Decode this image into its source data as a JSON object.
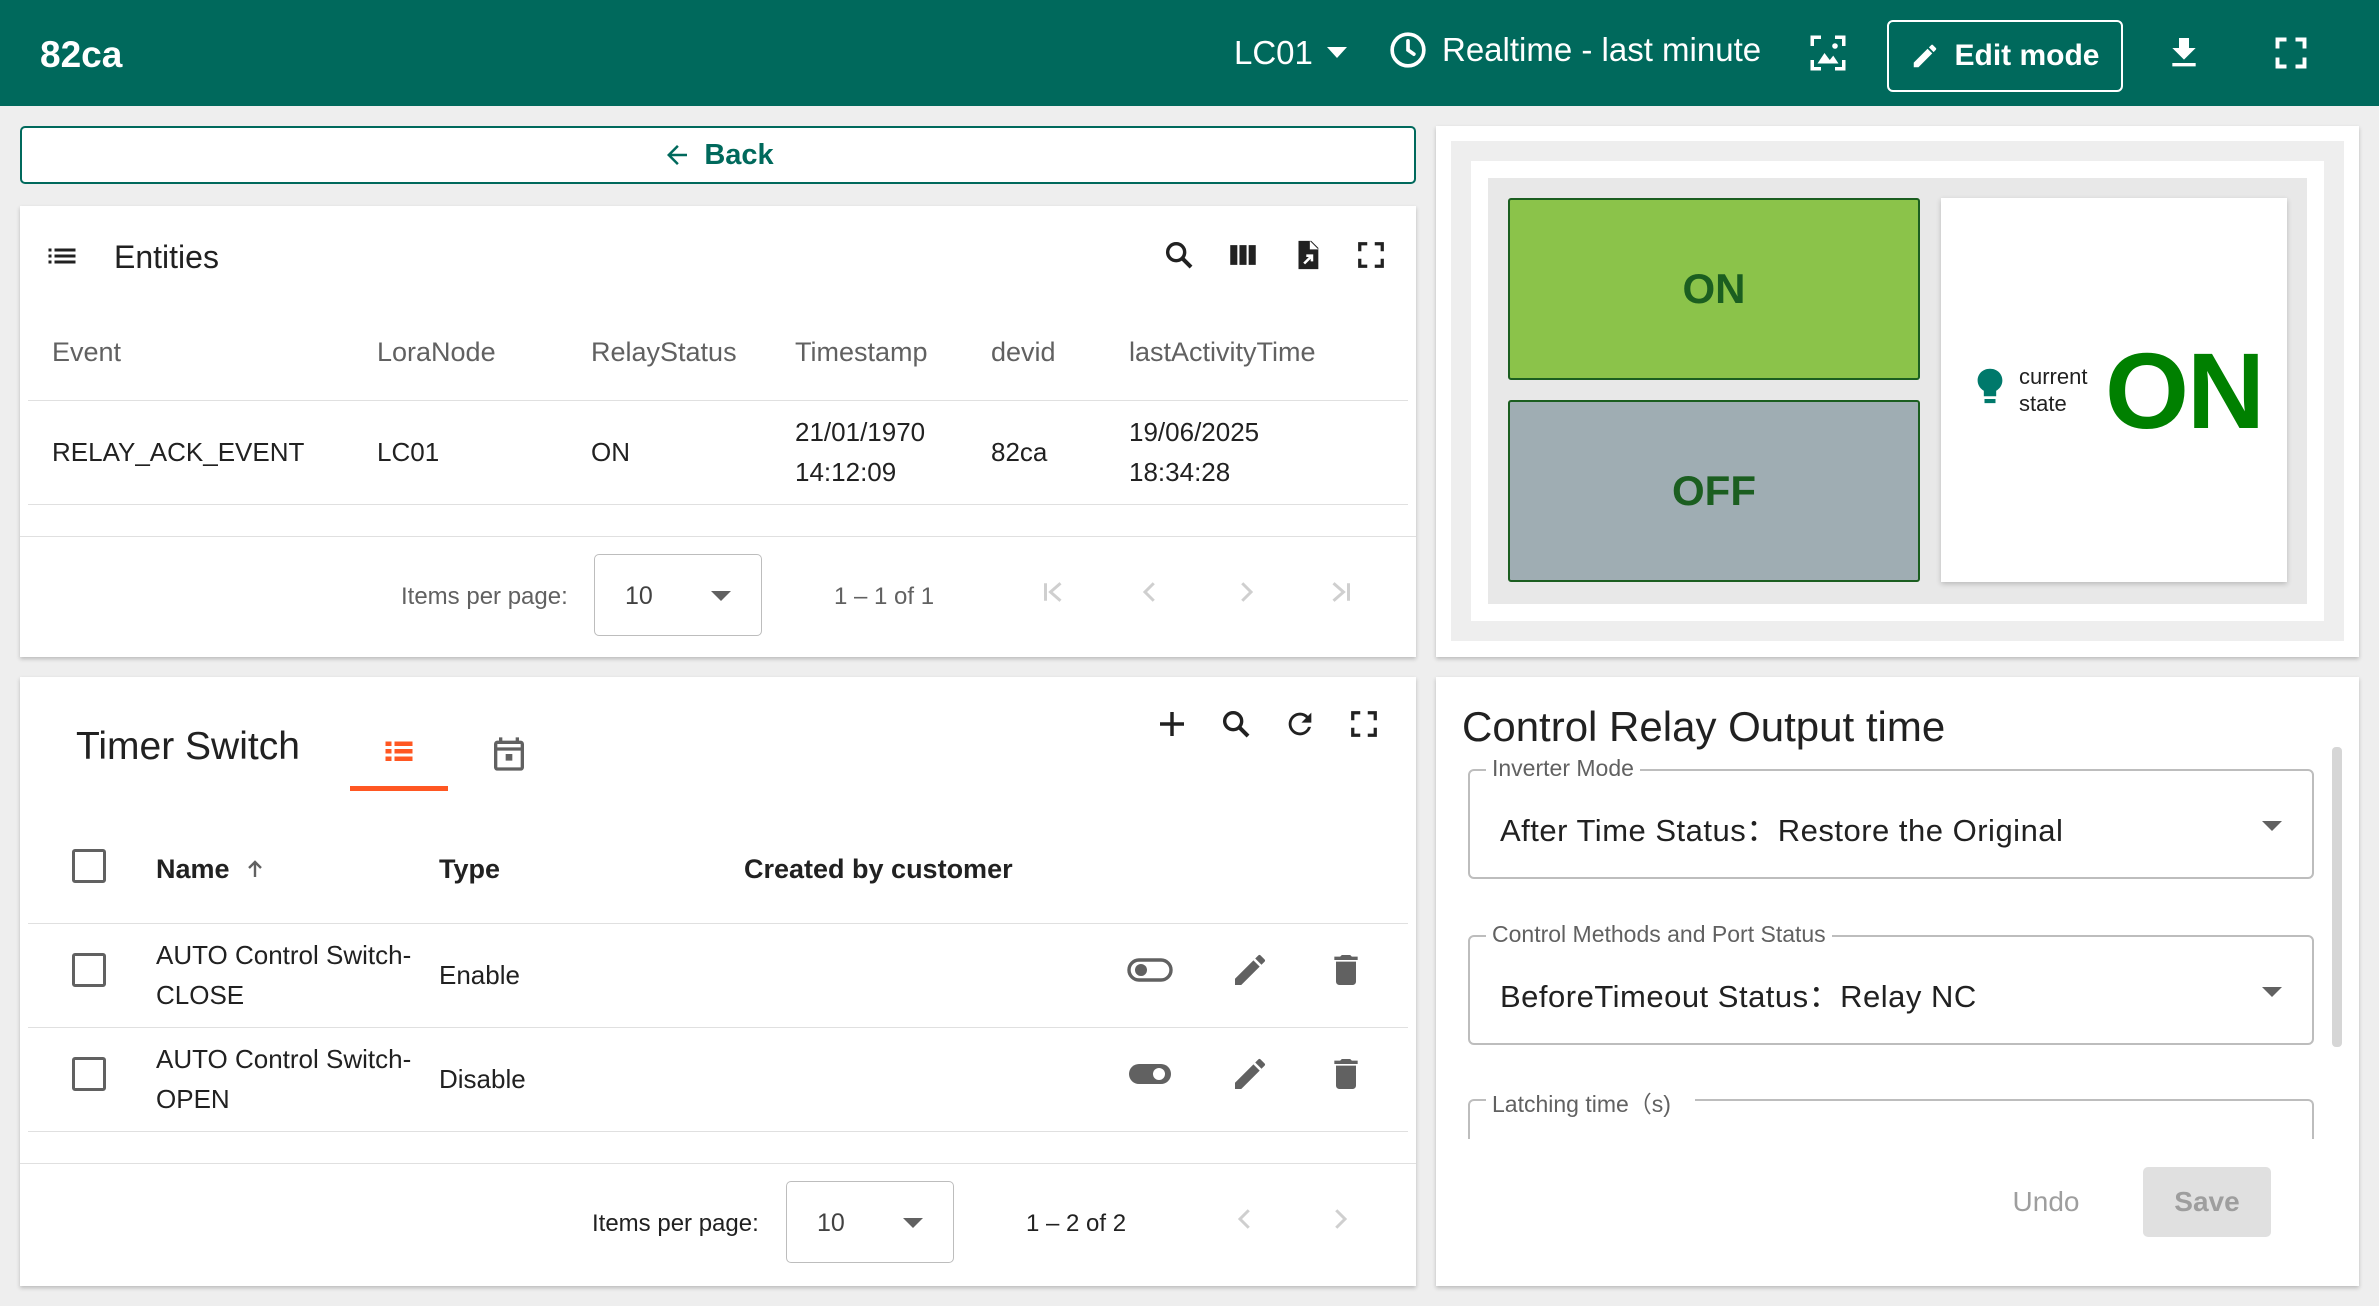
{
  "header": {
    "title": "82ca",
    "device_selector": "LC01",
    "time_window": "Realtime - last minute",
    "edit_mode_label": "Edit mode"
  },
  "back_label": "Back",
  "entities": {
    "title": "Entities",
    "columns": [
      "Event",
      "LoraNode",
      "RelayStatus",
      "Timestamp",
      "devid",
      "lastActivityTime"
    ],
    "rows": [
      {
        "event": "RELAY_ACK_EVENT",
        "loranode": "LC01",
        "relaystatus": "ON",
        "timestamp_date": "21/01/1970",
        "timestamp_time": "14:12:09",
        "devid": "82ca",
        "last_date": "19/06/2025",
        "last_time": "18:34:28"
      }
    ],
    "pager": {
      "items_label": "Items per page:",
      "page_size": "10",
      "range": "1 – 1 of 1"
    }
  },
  "relay": {
    "on_label": "ON",
    "off_label": "OFF",
    "current_state_line1": "current",
    "current_state_line2": "state",
    "current_state_value": "ON",
    "on_color": "#8bc34a",
    "off_color": "#9fadb3",
    "state_color": "#008000"
  },
  "timer": {
    "title": "Timer Switch",
    "columns": {
      "name": "Name",
      "type": "Type",
      "created": "Created by customer"
    },
    "rows": [
      {
        "name_line1": "AUTO Control Switch-",
        "name_line2": "CLOSE",
        "type": "Enable"
      },
      {
        "name_line1": "AUTO Control Switch-",
        "name_line2": "OPEN",
        "type": "Disable"
      }
    ],
    "pager": {
      "items_label": "Items per page:",
      "page_size": "10",
      "range": "1 – 2 of 2"
    },
    "accent_color": "#ff5722"
  },
  "control": {
    "title": "Control Relay Output time",
    "fields": [
      {
        "label": "Inverter Mode",
        "value": "After Time Status：Restore the Original"
      },
      {
        "label": "Control Methods and Port Status",
        "value": "BeforeTimeout Status：Relay NC"
      },
      {
        "label": "Latching time（s)",
        "value": ""
      }
    ],
    "undo_label": "Undo",
    "save_label": "Save"
  },
  "colors": {
    "primary": "#00695c",
    "background": "#eeeeee"
  }
}
